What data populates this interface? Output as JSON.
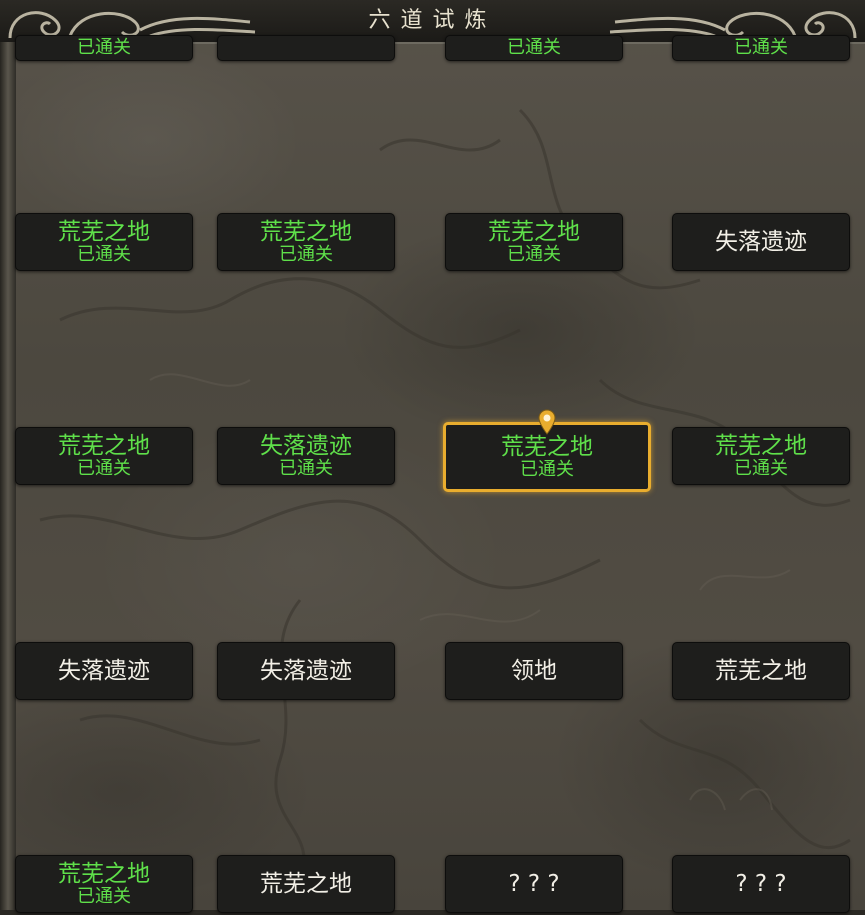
{
  "header": {
    "title": "六道试炼"
  },
  "colors": {
    "cleared_text": "#5fe04a",
    "uncleared_text": "#f2efe6",
    "active_border": "#e9ad2e",
    "tile_bg": "#1e1e1c"
  },
  "rows": [
    {
      "tiles": [
        {
          "name": "",
          "status": "已通关",
          "cleared": true
        },
        {
          "name": "",
          "status": "",
          "cleared": false
        },
        {
          "name": "",
          "status": "已通关",
          "cleared": true
        },
        {
          "name": "",
          "status": "已通关",
          "cleared": true
        }
      ]
    },
    {
      "tiles": [
        {
          "name": "荒芜之地",
          "status": "已通关",
          "cleared": true
        },
        {
          "name": "荒芜之地",
          "status": "已通关",
          "cleared": true
        },
        {
          "name": "荒芜之地",
          "status": "已通关",
          "cleared": true
        },
        {
          "name": "失落遗迹",
          "status": "",
          "cleared": false
        }
      ]
    },
    {
      "tiles": [
        {
          "name": "荒芜之地",
          "status": "已通关",
          "cleared": true
        },
        {
          "name": "失落遗迹",
          "status": "已通关",
          "cleared": true
        },
        {
          "name": "荒芜之地",
          "status": "已通关",
          "cleared": true,
          "current": true
        },
        {
          "name": "荒芜之地",
          "status": "已通关",
          "cleared": true
        }
      ]
    },
    {
      "tiles": [
        {
          "name": "失落遗迹",
          "status": "",
          "cleared": false
        },
        {
          "name": "失落遗迹",
          "status": "",
          "cleared": false
        },
        {
          "name": "领地",
          "status": "",
          "cleared": false
        },
        {
          "name": "荒芜之地",
          "status": "",
          "cleared": false
        }
      ]
    },
    {
      "tiles": [
        {
          "name": "荒芜之地",
          "status": "已通关",
          "cleared": true
        },
        {
          "name": "荒芜之地",
          "status": "",
          "cleared": false
        },
        {
          "name": "? ? ?",
          "status": "",
          "cleared": false
        },
        {
          "name": "? ? ?",
          "status": "",
          "cleared": false
        }
      ]
    }
  ],
  "icons": {
    "ornament_left": "cloud-scroll-ornament",
    "ornament_right": "cloud-scroll-ornament",
    "pin": "location-pin-icon"
  }
}
